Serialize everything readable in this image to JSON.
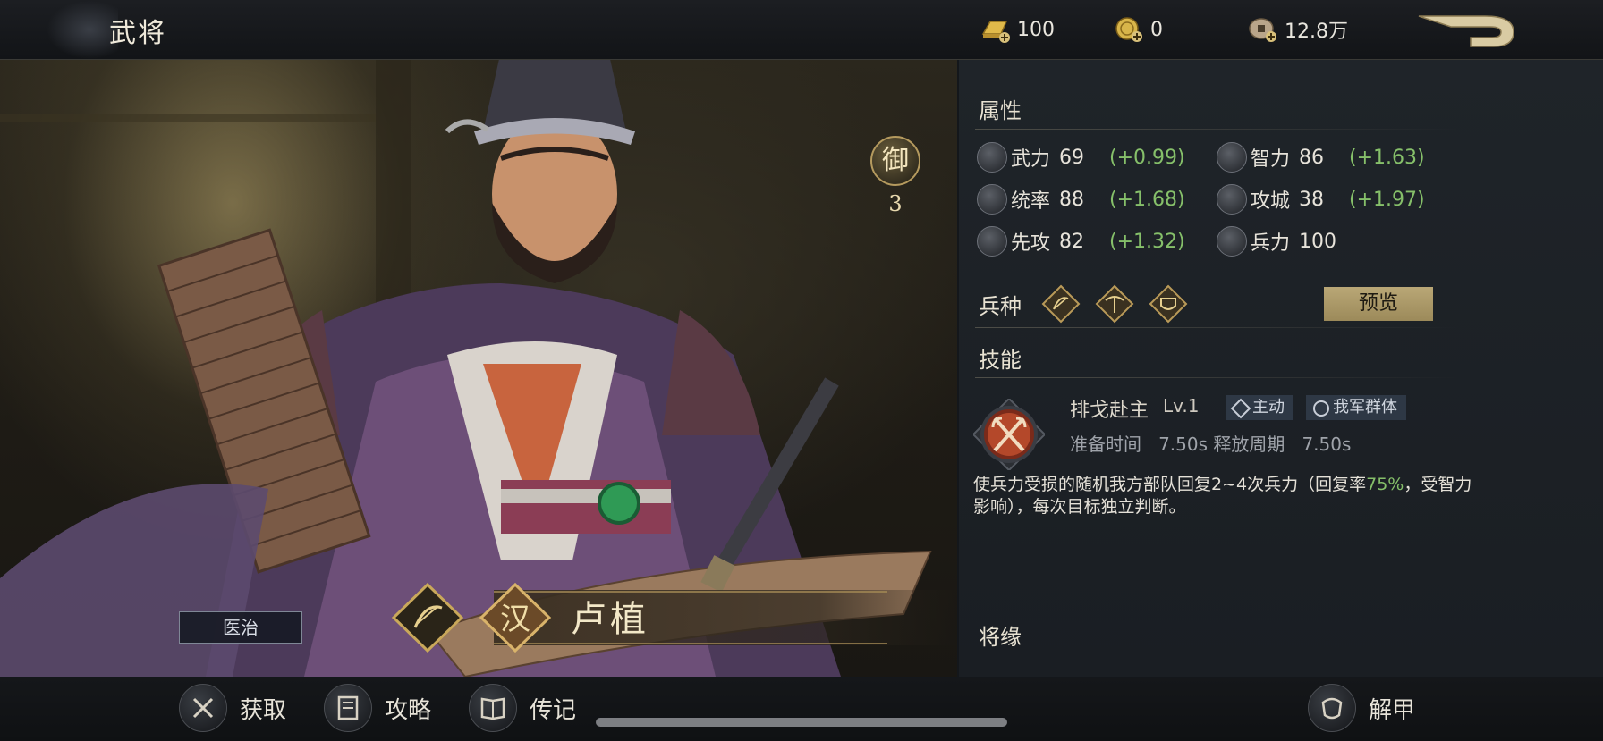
{
  "header": {
    "title": "武将",
    "resources": [
      {
        "icon": "gold-bar-plus-icon",
        "value": "100"
      },
      {
        "icon": "gold-coin-plus-icon",
        "value": "0"
      },
      {
        "icon": "copper-coins-plus-icon",
        "value": "12.8万"
      }
    ],
    "back_icon": "return-arrow-icon"
  },
  "hero": {
    "name": "卢植",
    "tag": "医治",
    "guard_char": "御",
    "guard_level": "3",
    "class_icons": [
      "bow-icon",
      "faction-han-icon"
    ]
  },
  "attributes": {
    "title": "属性",
    "items": [
      {
        "name": "武力",
        "value": "69",
        "bonus": "(+0.99)",
        "icon": "crossed-swords-icon"
      },
      {
        "name": "智力",
        "value": "86",
        "bonus": "(+1.63)",
        "icon": "feather-icon"
      },
      {
        "name": "统率",
        "value": "88",
        "bonus": "(+1.68)",
        "icon": "horse-icon"
      },
      {
        "name": "攻城",
        "value": "38",
        "bonus": "(+1.97)",
        "icon": "siege-icon"
      },
      {
        "name": "先攻",
        "value": "82",
        "bonus": "(+1.32)",
        "icon": "speed-icon"
      },
      {
        "name": "兵力",
        "value": "100",
        "bonus": "",
        "icon": "soldier-icon"
      }
    ]
  },
  "troops": {
    "title": "兵种",
    "icons": [
      "archer-unit-icon",
      "crossbow-unit-icon",
      "shield-unit-icon"
    ],
    "preview_label": "预览"
  },
  "skill": {
    "title": "技能",
    "icon": "crossed-halberds-icon",
    "name": "排戈赴主",
    "level": "Lv.1",
    "tags": [
      "主动",
      "我军群体"
    ],
    "time_text": "准备时间   7.50s 释放周期   7.50s",
    "desc_part1": "使兵力受损的随机我方部队回复2~4次兵力（回复率",
    "desc_highlight": "75%",
    "desc_part2": "，受智力影响），每次目标独立判断。"
  },
  "fate": {
    "title": "将缘"
  },
  "bottom_nav": [
    {
      "label": "获取",
      "icon": "acquire-icon"
    },
    {
      "label": "攻略",
      "icon": "guide-scroll-icon"
    },
    {
      "label": "传记",
      "icon": "biography-book-icon"
    },
    {
      "label": "解甲",
      "icon": "dismiss-armor-icon"
    }
  ],
  "colors": {
    "bonus_green": "#86c06a",
    "gold_accent": "#b59a5e",
    "preview_button": "#ac9a68"
  }
}
